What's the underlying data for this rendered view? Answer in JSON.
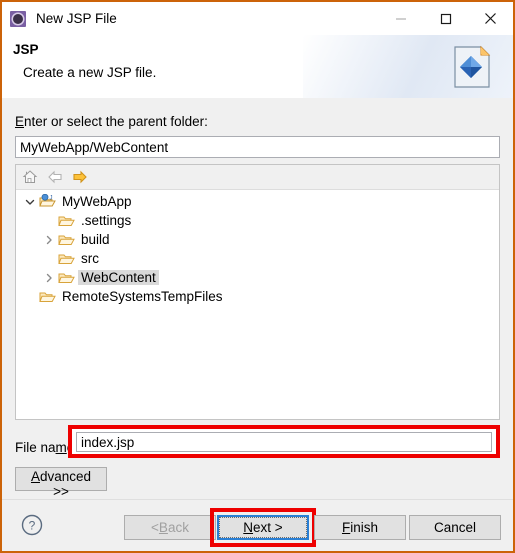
{
  "window": {
    "title": "New JSP File",
    "title_icon": "jsp-wizard-icon",
    "border_color": "#cc6309",
    "controls": [
      {
        "name": "minimize-button",
        "glyph": "minimize-icon"
      },
      {
        "name": "maximize-button",
        "glyph": "maximize-icon"
      },
      {
        "name": "close-button",
        "glyph": "close-icon"
      }
    ]
  },
  "banner": {
    "title": "JSP",
    "subtitle": "Create a new JSP file.",
    "icon": "jsp-file-icon"
  },
  "form": {
    "parent_folder_label": "Enter or select the parent folder:",
    "parent_folder_label_mnemonic": "E",
    "parent_folder_value": "MyWebApp/WebContent",
    "parent_folder_placeholder": "",
    "file_name_label_pre": "File na",
    "file_name_label_mnemonic": "m",
    "file_name_label_post": "e:",
    "file_name_value": "index.jsp",
    "file_name_placeholder": "",
    "file_name_highlight_color": "#ee0000",
    "advanced_label_mnemonic": "A",
    "advanced_label_rest": "dvanced >>"
  },
  "tree_toolbar": [
    {
      "name": "home-icon",
      "label": "Home",
      "enabled": false
    },
    {
      "name": "back-arrow-icon",
      "label": "Back",
      "enabled": false
    },
    {
      "name": "forward-arrow-icon",
      "label": "Forward",
      "enabled": true
    }
  ],
  "tree": {
    "rows": [
      {
        "label": "MyWebApp",
        "indent": 0,
        "twisty": "down",
        "icon": "web-project-icon",
        "selected": false
      },
      {
        "label": ".settings",
        "indent": 1,
        "twisty": "none",
        "icon": "folder-icon",
        "selected": false
      },
      {
        "label": "build",
        "indent": 1,
        "twisty": "right",
        "icon": "folder-icon",
        "selected": false
      },
      {
        "label": "src",
        "indent": 1,
        "twisty": "none",
        "icon": "folder-icon",
        "selected": false
      },
      {
        "label": "WebContent",
        "indent": 1,
        "twisty": "right",
        "icon": "folder-icon",
        "selected": true
      },
      {
        "label": "RemoteSystemsTempFiles",
        "indent": 0,
        "twisty": "none",
        "icon": "folder-icon",
        "selected": false
      }
    ]
  },
  "footer": {
    "help_icon": "help-icon",
    "buttons": [
      {
        "name": "back-button",
        "pre": "< ",
        "mnemonic": "B",
        "post": "ack",
        "enabled": false,
        "focused": false
      },
      {
        "name": "next-button",
        "pre": "",
        "mnemonic": "N",
        "post": "ext >",
        "enabled": true,
        "focused": true
      },
      {
        "name": "finish-button",
        "pre": "",
        "mnemonic": "F",
        "post": "inish",
        "enabled": true,
        "focused": false
      },
      {
        "name": "cancel-button",
        "pre": "Cancel",
        "mnemonic": "",
        "post": "",
        "enabled": true,
        "focused": false
      }
    ],
    "highlight_color": "#ee0000"
  }
}
